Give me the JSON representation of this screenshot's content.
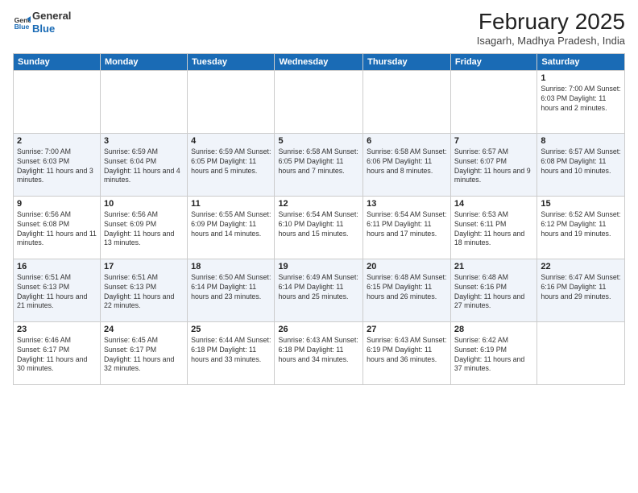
{
  "header": {
    "logo_general": "General",
    "logo_blue": "Blue",
    "month_title": "February 2025",
    "location": "Isagarh, Madhya Pradesh, India"
  },
  "weekdays": [
    "Sunday",
    "Monday",
    "Tuesday",
    "Wednesday",
    "Thursday",
    "Friday",
    "Saturday"
  ],
  "weeks": [
    {
      "days": [
        {
          "num": "",
          "info": ""
        },
        {
          "num": "",
          "info": ""
        },
        {
          "num": "",
          "info": ""
        },
        {
          "num": "",
          "info": ""
        },
        {
          "num": "",
          "info": ""
        },
        {
          "num": "",
          "info": ""
        },
        {
          "num": "1",
          "info": "Sunrise: 7:00 AM\nSunset: 6:03 PM\nDaylight: 11 hours\nand 2 minutes."
        }
      ]
    },
    {
      "days": [
        {
          "num": "2",
          "info": "Sunrise: 7:00 AM\nSunset: 6:03 PM\nDaylight: 11 hours\nand 3 minutes."
        },
        {
          "num": "3",
          "info": "Sunrise: 6:59 AM\nSunset: 6:04 PM\nDaylight: 11 hours\nand 4 minutes."
        },
        {
          "num": "4",
          "info": "Sunrise: 6:59 AM\nSunset: 6:05 PM\nDaylight: 11 hours\nand 5 minutes."
        },
        {
          "num": "5",
          "info": "Sunrise: 6:58 AM\nSunset: 6:05 PM\nDaylight: 11 hours\nand 7 minutes."
        },
        {
          "num": "6",
          "info": "Sunrise: 6:58 AM\nSunset: 6:06 PM\nDaylight: 11 hours\nand 8 minutes."
        },
        {
          "num": "7",
          "info": "Sunrise: 6:57 AM\nSunset: 6:07 PM\nDaylight: 11 hours\nand 9 minutes."
        },
        {
          "num": "8",
          "info": "Sunrise: 6:57 AM\nSunset: 6:08 PM\nDaylight: 11 hours\nand 10 minutes."
        }
      ]
    },
    {
      "days": [
        {
          "num": "9",
          "info": "Sunrise: 6:56 AM\nSunset: 6:08 PM\nDaylight: 11 hours\nand 11 minutes."
        },
        {
          "num": "10",
          "info": "Sunrise: 6:56 AM\nSunset: 6:09 PM\nDaylight: 11 hours\nand 13 minutes."
        },
        {
          "num": "11",
          "info": "Sunrise: 6:55 AM\nSunset: 6:09 PM\nDaylight: 11 hours\nand 14 minutes."
        },
        {
          "num": "12",
          "info": "Sunrise: 6:54 AM\nSunset: 6:10 PM\nDaylight: 11 hours\nand 15 minutes."
        },
        {
          "num": "13",
          "info": "Sunrise: 6:54 AM\nSunset: 6:11 PM\nDaylight: 11 hours\nand 17 minutes."
        },
        {
          "num": "14",
          "info": "Sunrise: 6:53 AM\nSunset: 6:11 PM\nDaylight: 11 hours\nand 18 minutes."
        },
        {
          "num": "15",
          "info": "Sunrise: 6:52 AM\nSunset: 6:12 PM\nDaylight: 11 hours\nand 19 minutes."
        }
      ]
    },
    {
      "days": [
        {
          "num": "16",
          "info": "Sunrise: 6:51 AM\nSunset: 6:13 PM\nDaylight: 11 hours\nand 21 minutes."
        },
        {
          "num": "17",
          "info": "Sunrise: 6:51 AM\nSunset: 6:13 PM\nDaylight: 11 hours\nand 22 minutes."
        },
        {
          "num": "18",
          "info": "Sunrise: 6:50 AM\nSunset: 6:14 PM\nDaylight: 11 hours\nand 23 minutes."
        },
        {
          "num": "19",
          "info": "Sunrise: 6:49 AM\nSunset: 6:14 PM\nDaylight: 11 hours\nand 25 minutes."
        },
        {
          "num": "20",
          "info": "Sunrise: 6:48 AM\nSunset: 6:15 PM\nDaylight: 11 hours\nand 26 minutes."
        },
        {
          "num": "21",
          "info": "Sunrise: 6:48 AM\nSunset: 6:16 PM\nDaylight: 11 hours\nand 27 minutes."
        },
        {
          "num": "22",
          "info": "Sunrise: 6:47 AM\nSunset: 6:16 PM\nDaylight: 11 hours\nand 29 minutes."
        }
      ]
    },
    {
      "days": [
        {
          "num": "23",
          "info": "Sunrise: 6:46 AM\nSunset: 6:17 PM\nDaylight: 11 hours\nand 30 minutes."
        },
        {
          "num": "24",
          "info": "Sunrise: 6:45 AM\nSunset: 6:17 PM\nDaylight: 11 hours\nand 32 minutes."
        },
        {
          "num": "25",
          "info": "Sunrise: 6:44 AM\nSunset: 6:18 PM\nDaylight: 11 hours\nand 33 minutes."
        },
        {
          "num": "26",
          "info": "Sunrise: 6:43 AM\nSunset: 6:18 PM\nDaylight: 11 hours\nand 34 minutes."
        },
        {
          "num": "27",
          "info": "Sunrise: 6:43 AM\nSunset: 6:19 PM\nDaylight: 11 hours\nand 36 minutes."
        },
        {
          "num": "28",
          "info": "Sunrise: 6:42 AM\nSunset: 6:19 PM\nDaylight: 11 hours\nand 37 minutes."
        },
        {
          "num": "",
          "info": ""
        }
      ]
    }
  ]
}
